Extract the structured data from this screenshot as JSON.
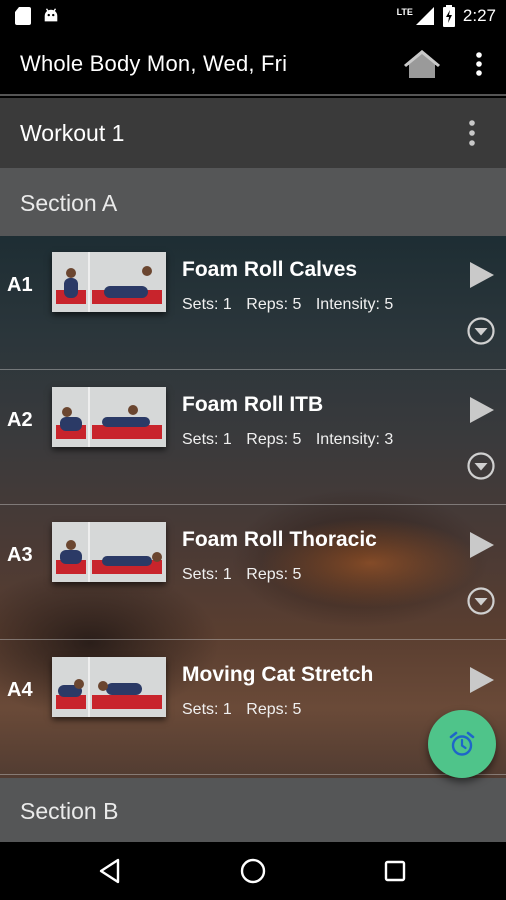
{
  "status_bar": {
    "network": "LTE",
    "time": "2:27"
  },
  "app_bar": {
    "title": "Whole Body Mon, Wed, Fri"
  },
  "workout": {
    "title": "Workout 1"
  },
  "sections": [
    {
      "label": "Section A"
    },
    {
      "label": "Section B"
    }
  ],
  "exercises": [
    {
      "id": "A1",
      "name": "Foam Roll Calves",
      "sets": "Sets: 1",
      "reps": "Reps: 5",
      "intensity": "Intensity: 5"
    },
    {
      "id": "A2",
      "name": "Foam Roll ITB",
      "sets": "Sets: 1",
      "reps": "Reps: 5",
      "intensity": "Intensity: 3"
    },
    {
      "id": "A3",
      "name": "Foam Roll Thoracic",
      "sets": "Sets: 1",
      "reps": "Reps: 5"
    },
    {
      "id": "A4",
      "name": "Moving Cat Stretch",
      "sets": "Sets: 1",
      "reps": "Reps: 5"
    }
  ],
  "colors": {
    "fab": "#4fc48a",
    "fab_icon": "#1e66c8",
    "section_bg": "#555657",
    "workout_bg": "#3a3a3a",
    "mat": "#c8242c"
  },
  "icons": [
    "sd-card-icon",
    "android-icon",
    "signal-icon",
    "battery-icon",
    "home-icon",
    "overflow-menu-icon",
    "play-icon",
    "expand-circle-icon",
    "alarm-icon",
    "back-icon",
    "home-circle-icon",
    "recents-icon"
  ]
}
